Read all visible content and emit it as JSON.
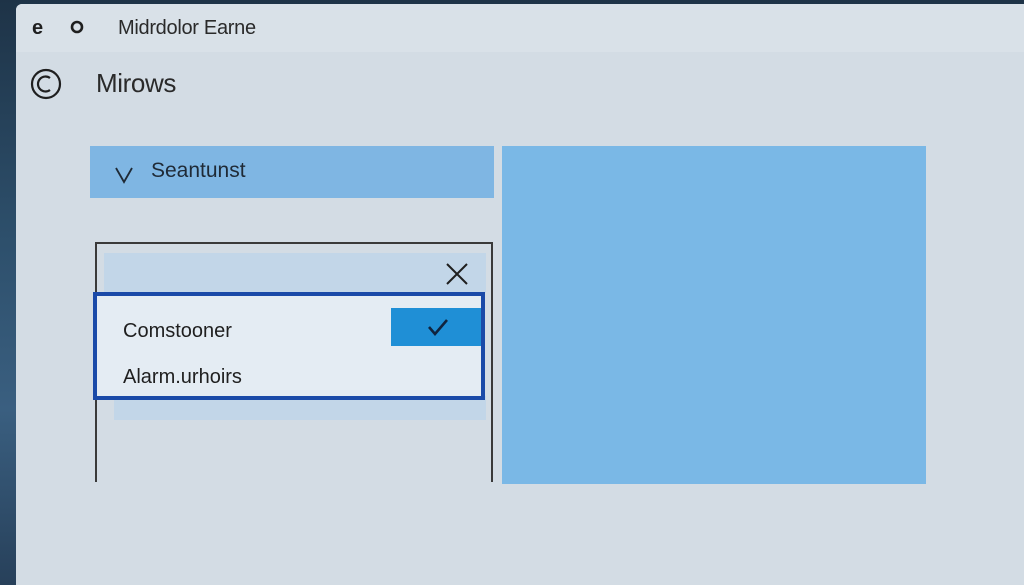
{
  "window": {
    "app_icon_glyph": "e",
    "app_title": "Midrdolor Earne"
  },
  "header": {
    "page_title": "Mirows"
  },
  "search": {
    "label": "Seantunst"
  },
  "dialog": {
    "options": [
      {
        "label": "Comstooner",
        "selected": true
      },
      {
        "label": "Alarm.urhoirs",
        "selected": false
      }
    ]
  },
  "colors": {
    "accent": "#1f8fd6",
    "panel": "#7ab8e6",
    "focus_border": "#1a4aa8",
    "surface": "#d3dce4"
  },
  "icons": [
    "app-icon",
    "record-icon",
    "back-icon",
    "chevron-down-icon",
    "close-icon",
    "checkmark-icon"
  ]
}
